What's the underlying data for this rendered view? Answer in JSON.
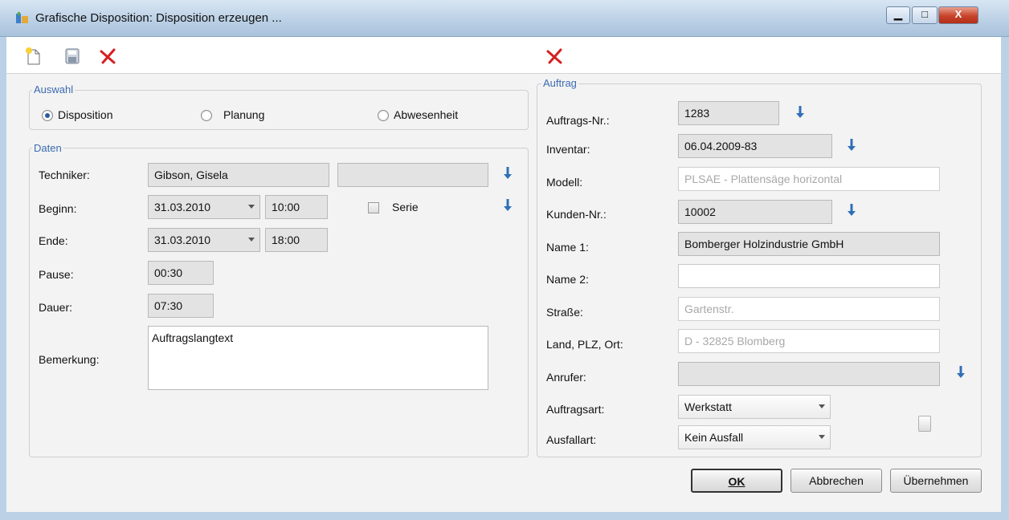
{
  "window": {
    "title": "Grafische Disposition: Disposition erzeugen ...",
    "minimize_glyph": "▁",
    "maximize_glyph": "□",
    "close_glyph": "X"
  },
  "toolbar": {
    "icons": [
      "new-document-icon",
      "save-icon",
      "delete-icon"
    ],
    "right_icons": [
      "delete-icon"
    ]
  },
  "auswahl": {
    "title": "Auswahl",
    "options": [
      {
        "label": "Disposition",
        "selected": true
      },
      {
        "label": "Planung",
        "selected": false
      },
      {
        "label": "Abwesenheit",
        "selected": false
      }
    ]
  },
  "daten": {
    "title": "Daten",
    "techniker_label": "Techniker:",
    "techniker_value": "Gibson, Gisela",
    "techniker_extra": "",
    "beginn_label": "Beginn:",
    "beginn_date": "31.03.2010",
    "beginn_time": "10:00",
    "serie_label": "Serie",
    "serie_checked": false,
    "ende_label": "Ende:",
    "ende_date": "31.03.2010",
    "ende_time": "18:00",
    "pause_label": "Pause:",
    "pause_value": "00:30",
    "dauer_label": "Dauer:",
    "dauer_value": "07:30",
    "bemerkung_label": "Bemerkung:",
    "bemerkung_value": "Auftragslangtext"
  },
  "auftrag": {
    "title": "Auftrag",
    "auftrags_nr_label": "Auftrags-Nr.:",
    "auftrags_nr_value": "1283",
    "inventar_label": "Inventar:",
    "inventar_value": "06.04.2009-83",
    "modell_label": "Modell:",
    "modell_value": "PLSAE - Plattensäge horizontal",
    "kunden_nr_label": "Kunden-Nr.:",
    "kunden_nr_value": "10002",
    "name1_label": "Name 1:",
    "name1_value": "Bomberger Holzindustrie GmbH",
    "name2_label": "Name 2:",
    "name2_value": "",
    "strasse_label": "Straße:",
    "strasse_value": "Gartenstr.",
    "ort_label": "Land, PLZ, Ort:",
    "ort_value": "D - 32825 Blomberg",
    "anrufer_label": "Anrufer:",
    "anrufer_value": "",
    "auftragsart_label": "Auftragsart:",
    "auftragsart_value": "Werkstatt",
    "ausfallart_label": "Ausfallart:",
    "ausfallart_value": "Kein Ausfall"
  },
  "buttons": {
    "ok": "OK",
    "abbrechen": "Abbrechen",
    "uebernehmen": "Übernehmen"
  },
  "colors": {
    "accent_blue": "#2f6fb8",
    "delete_red": "#d42020",
    "group_title": "#3c6bb0"
  }
}
